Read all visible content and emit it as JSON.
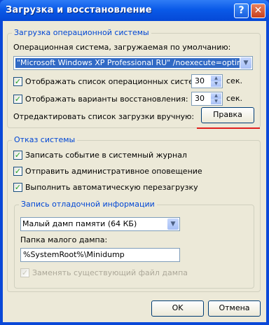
{
  "window": {
    "title": "Загрузка и восстановление",
    "help_glyph": "?",
    "close_glyph": "✕"
  },
  "startup": {
    "group_title": "Загрузка операционной системы",
    "default_os_label": "Операционная система, загружаемая по умолчанию:",
    "default_os_value": "\"Microsoft Windows XP Professional RU\" /noexecute=optin /fastd",
    "show_os_list_label": "Отображать список операционных систем:",
    "show_os_list_checked": true,
    "show_os_list_value": "30",
    "show_recovery_label": "Отображать варианты восстановления:",
    "show_recovery_checked": true,
    "show_recovery_value": "30",
    "seconds_unit": "сек.",
    "edit_label": "Отредактировать список загрузки вручную:",
    "edit_button": "Правка"
  },
  "failure": {
    "group_title": "Отказ системы",
    "options": [
      {
        "label": "Записать событие в системный журнал",
        "checked": true
      },
      {
        "label": "Отправить административное оповещение",
        "checked": true
      },
      {
        "label": "Выполнить автоматическую перезагрузку",
        "checked": true
      }
    ],
    "debug": {
      "group_title": "Запись отладочной информации",
      "dump_type": "Малый дамп памяти (64 КБ)",
      "dump_folder_label": "Папка малого дампа:",
      "dump_folder_value": "%SystemRoot%\\Minidump",
      "overwrite_label": "Заменять существующий файл дампа",
      "overwrite_checked": true,
      "overwrite_enabled": false
    }
  },
  "footer": {
    "ok": "OK",
    "cancel": "Отмена"
  },
  "colors": {
    "title_bar": "#0a5ae8",
    "group_title": "#0046d5",
    "annotation_underline": "#e0201e"
  }
}
